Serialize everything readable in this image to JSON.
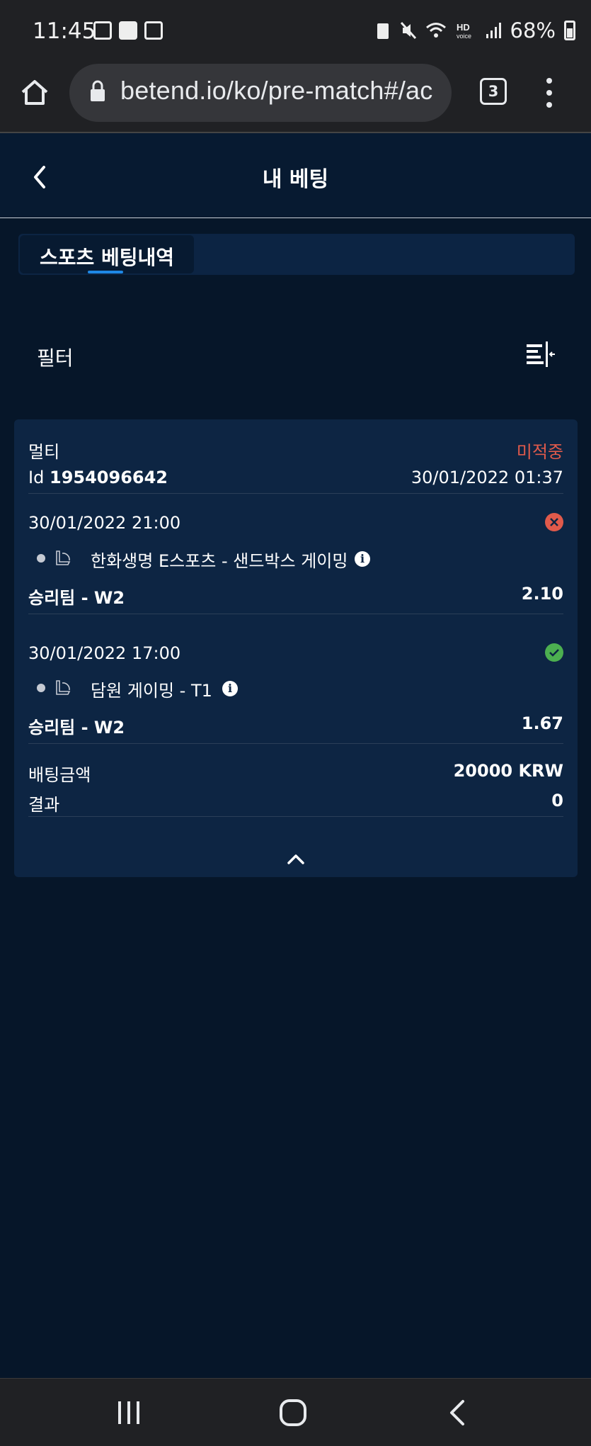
{
  "status_bar": {
    "time": "11:45",
    "battery": "68%",
    "icons": [
      "gallery-icon",
      "webtoon-icon",
      "twitch-icon",
      "battery-saver-icon",
      "mute-icon",
      "wifi-icon",
      "hd-voice-icon",
      "signal-icon",
      "battery-icon"
    ]
  },
  "browser": {
    "url": "betend.io/ko/pre-match#/ac",
    "tab_count": "3"
  },
  "header": {
    "title": "내 베팅"
  },
  "tabs": [
    {
      "label": "스포츠 베팅내역",
      "active": true
    }
  ],
  "filter": {
    "label": "필터"
  },
  "bet": {
    "type": "멀티",
    "status": "미적중",
    "id_label": "Id",
    "id_value": "1954096642",
    "placed_at": "30/01/2022 01:37",
    "selections": [
      {
        "datetime": "30/01/2022 21:00",
        "match": "한화생명 E스포츠 - 샌드박스 게이밍",
        "market": "승리팀 - W2",
        "odds": "2.10",
        "result": "lost"
      },
      {
        "datetime": "30/01/2022 17:00",
        "match": "담원 게이밍 - T1",
        "market": "승리팀 - W2",
        "odds": "1.67",
        "result": "won"
      }
    ],
    "stake_label": "배팅금액",
    "stake_value": "20000 KRW",
    "result_label": "결과",
    "result_value": "0"
  },
  "colors": {
    "background": "#061629",
    "card": "#0d2543",
    "lost": "#e05a4b",
    "won": "#4caf50",
    "accent": "#1e88e5"
  }
}
